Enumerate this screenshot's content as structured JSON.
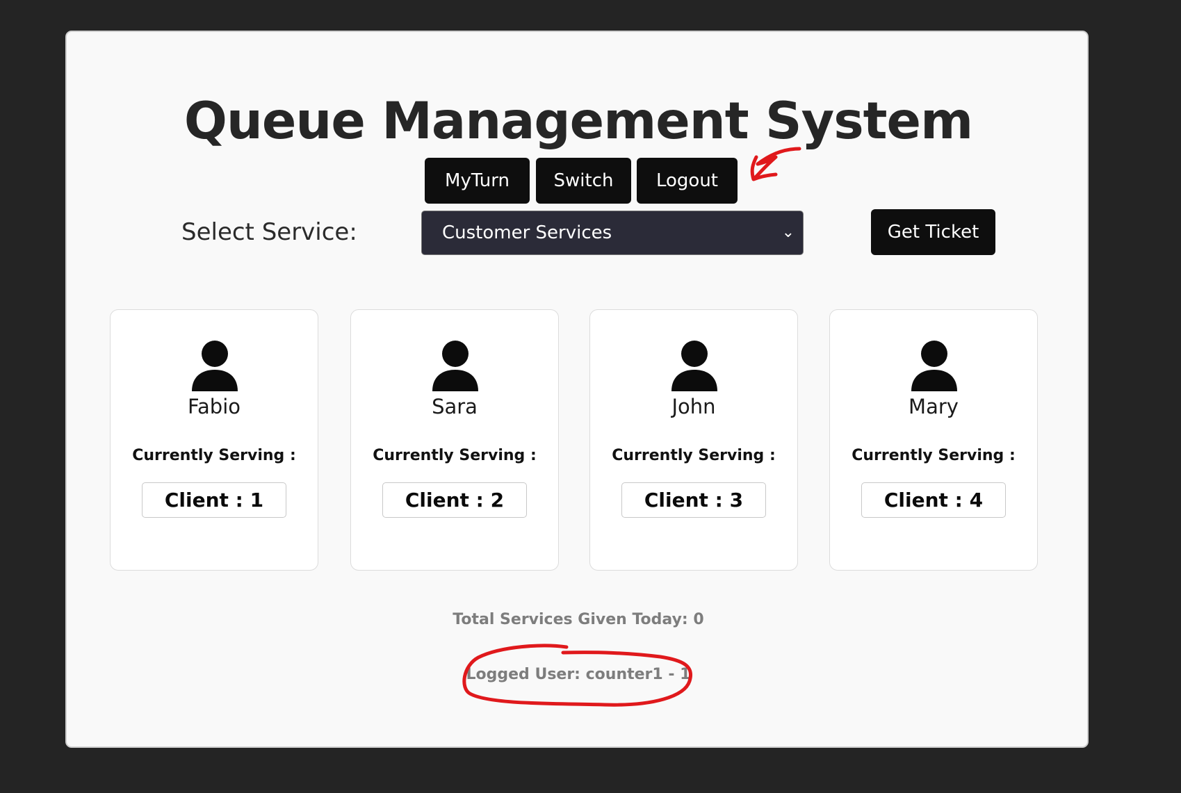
{
  "app": {
    "title": "Queue Management System"
  },
  "toolbar": {
    "myturn_label": "MyTurn",
    "switch_label": "Switch",
    "logout_label": "Logout"
  },
  "service": {
    "label": "Select Service:",
    "selected": "Customer Services",
    "ticket_label": "Get Ticket"
  },
  "counters": [
    {
      "name": "Fabio",
      "serving_label": "Currently Serving :",
      "client": "Client : 1"
    },
    {
      "name": "Sara",
      "serving_label": "Currently Serving :",
      "client": "Client : 2"
    },
    {
      "name": "John",
      "serving_label": "Currently Serving :",
      "client": "Client : 3"
    },
    {
      "name": "Mary",
      "serving_label": "Currently Serving :",
      "client": "Client : 4"
    }
  ],
  "footer": {
    "total_services": "Total Services Given Today: 0",
    "logged_user": "Logged User: counter1 - 1"
  },
  "icons": {
    "avatar": "user-icon",
    "select_arrow": "chevron-down-icon"
  },
  "colors": {
    "background": "#242424",
    "panel": "#f9f9f9",
    "button": "#0e0e0e",
    "select": "#2b2b38",
    "annotation": "#e0191c"
  }
}
